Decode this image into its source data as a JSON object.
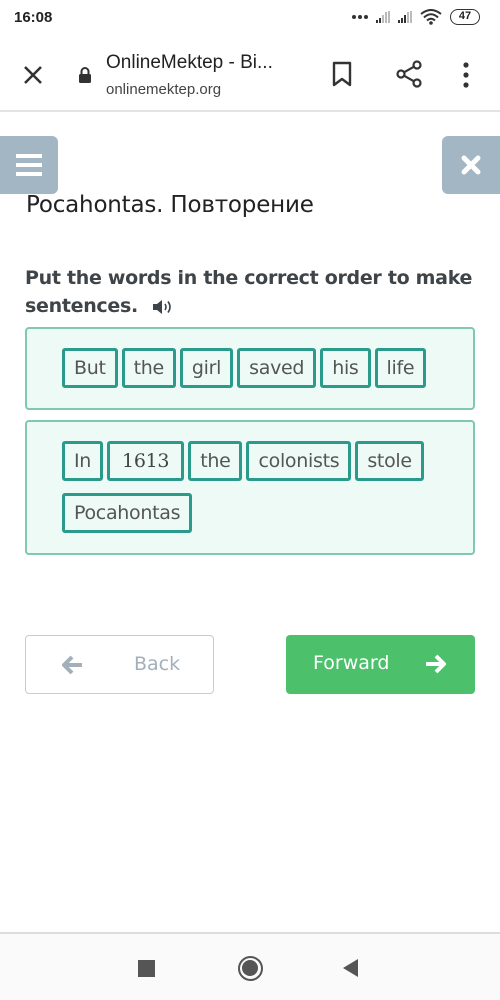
{
  "status_bar": {
    "time": "16:08",
    "battery": "47"
  },
  "browser": {
    "page_title": "OnlineMektep - Bi...",
    "url": "onlinemektep.org",
    "icons": [
      "close-icon",
      "lock-icon",
      "bookmark-icon",
      "share-icon",
      "more-vert-icon"
    ]
  },
  "page": {
    "lesson_title": "Pocahontas. Повторение",
    "instruction": "Put the words in the correct order to make sentences.",
    "sentences": [
      {
        "words": [
          "But",
          "the",
          "girl",
          "saved",
          "his",
          "life"
        ]
      },
      {
        "words": [
          "In",
          "1613",
          "the",
          "colonists",
          "stole",
          "Pocahontas"
        ]
      }
    ],
    "back_label": "Back",
    "forward_label": "Forward",
    "colors": {
      "side_button": "#a2b6c4",
      "word_border": "#2a9a8a",
      "box_background": "#eefaf6",
      "forward_button": "#4cc06b"
    }
  },
  "navbar": {
    "icons": [
      "recents-square-icon",
      "home-circle-icon",
      "back-triangle-icon"
    ]
  }
}
